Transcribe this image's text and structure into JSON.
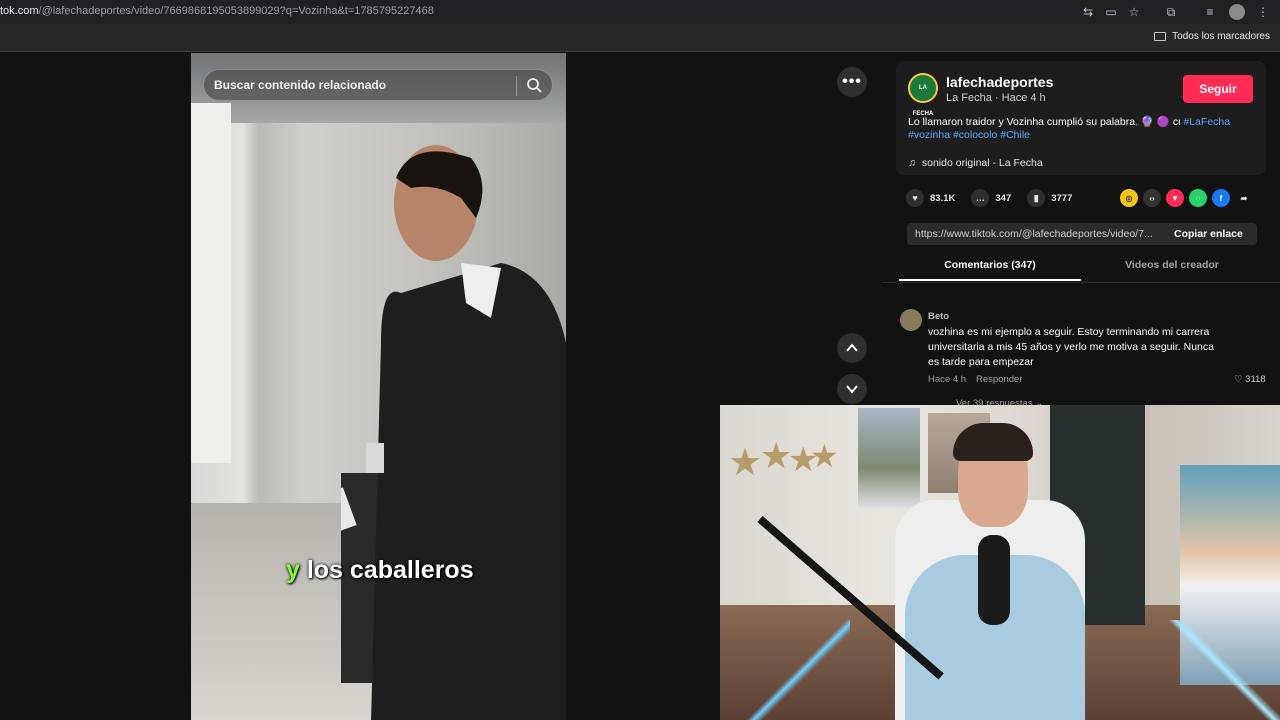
{
  "browser": {
    "url_host": "tok.com",
    "url_path": "/@lafechadeportes/video/7669868195053899029?q=Vozinha&t=1785795227468",
    "bookmarks_folder": "Todos los marcadores"
  },
  "video": {
    "search_placeholder": "Buscar contenido relacionado",
    "caption_highlight": "y",
    "caption_rest": " los caballeros"
  },
  "post": {
    "username": "lafechadeportes",
    "avatar_text": "LA FECHA",
    "subline": "La Fecha · Hace 4 h",
    "follow_label": "Seguir",
    "description": "Lo llamaron traidor y Vozinha cumplió su palabra. 🔮 🟣 cι ",
    "hashtags_line1": "#LaFecha",
    "hashtags_line2": [
      "#vozinha",
      "#colocolo",
      "#Chile"
    ],
    "sound": "sonido original - La Fecha",
    "likes": "83.1K",
    "comments": "347",
    "saves": "3777",
    "link_url": "https://www.tiktok.com/@lafechadeportes/video/7...",
    "copy_label": "Copiar enlace"
  },
  "tabs": {
    "comments": "Comentarios (347)",
    "creator_videos": "Videos del creador"
  },
  "comment": {
    "name": "Beto",
    "text": "vozhina es mi ejemplo a seguir. Estoy terminando mi carrera universitaria a mis 45 años y verlo me motiva a seguir. Nunca es tarde para empezar",
    "time": "Hace 4 h",
    "reply_label": "Responder",
    "likes": "3118",
    "view_replies": "Ver 39 respuestas"
  },
  "colors": {
    "follow": "#fe2c55",
    "hashtag": "#53a9ff",
    "caption_highlight": "#7fff3a"
  }
}
